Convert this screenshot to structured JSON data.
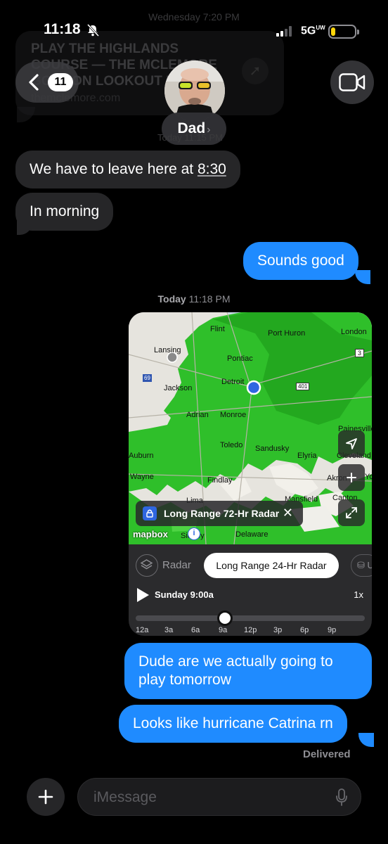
{
  "status_bar": {
    "time": "11:18",
    "network": "5G",
    "network_sup": "UW",
    "battery_percent": 20
  },
  "background": {
    "earlier_time": "Wednesday 7:20 PM",
    "link_preview": {
      "title": "PLAY THE HIGHLANDS COURSE — THE MCLEMORE GOLF ON LOOKOUT MTN.",
      "domain": "themclemore.com"
    }
  },
  "header": {
    "back_badge": "11",
    "contact_name": "Dad",
    "faded_today": "Today 11:15 PM"
  },
  "messages": [
    {
      "dir": "received",
      "text_before": "We have to leave here at ",
      "link": "8:30"
    },
    {
      "dir": "received",
      "text": "In morning"
    },
    {
      "dir": "sent",
      "text": "Sounds good"
    },
    {
      "dir": "sent",
      "text": "Dude are we actually going to play tomorrow"
    },
    {
      "dir": "sent",
      "text": "Looks like hurricane Catrina rn"
    }
  ],
  "timestamp": {
    "day": "Today",
    "time": "11:18 PM"
  },
  "map_card": {
    "cities": [
      "Flint",
      "Port Huron",
      "London",
      "Lansing",
      "Pontiac",
      "Jackson",
      "Detroit",
      "Adrian",
      "Monroe",
      "Toledo",
      "Sandusky",
      "Painesville",
      "Cleveland",
      "Elyria",
      "Auburn",
      "Wayne",
      "Findlay",
      "Akron",
      "Mansfield",
      "Canton",
      "Lima",
      "Sidney",
      "Delaware",
      "Yo"
    ],
    "road_shields": [
      "3",
      "401",
      "69"
    ],
    "overlay_label": "Long Range 72-Hr Radar",
    "attribution": "mapbox",
    "tabs": {
      "radar": "Radar",
      "active": "Long Range 24-Hr Radar",
      "locked": "U"
    },
    "playback_time": "Sunday 9:00a",
    "speed": "1x",
    "timeline_ticks": [
      "12a",
      "3a",
      "6a",
      "9a",
      "12p",
      "3p",
      "6p",
      "9p"
    ],
    "timeline_position": 0.39
  },
  "delivered": "Delivered",
  "composer": {
    "placeholder": "iMessage"
  },
  "colors": {
    "sent_bubble": "#1f8bff",
    "received_bubble": "#262628",
    "radar_green": "#2fbf2a",
    "battery": "#ffd60a"
  }
}
